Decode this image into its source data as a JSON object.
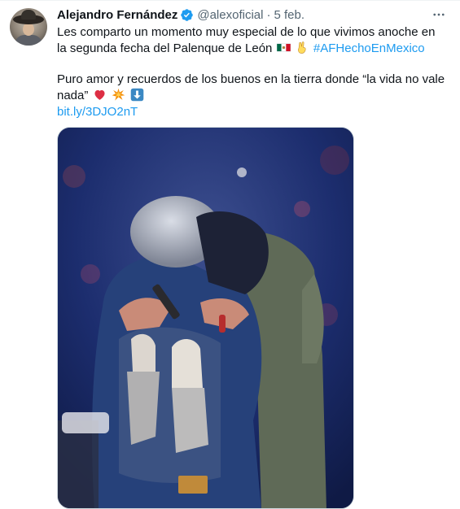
{
  "tweet": {
    "author_name": "Alejandro Fernández",
    "handle": "@alexoficial",
    "separator": "·",
    "date": "5 feb.",
    "text_line1": "Les comparto un momento muy especial de lo que vivimos anoche en la segunda fecha del Palenque de León",
    "hashtag": "#AFHechoEnMexico",
    "text_line2": "Puro amor y recuerdos de los buenos en la tierra donde “la vida no vale nada”",
    "link": "bit.ly/3DJO2nT",
    "emojis_line1": [
      "mexico-flag",
      "victory-hand"
    ],
    "emojis_line2": [
      "red-heart",
      "collision",
      "down-arrow"
    ],
    "media_description_icon": "concert-photo"
  },
  "colors": {
    "accent": "#1d9bf0",
    "text": "#0f1419",
    "muted": "#536471"
  }
}
